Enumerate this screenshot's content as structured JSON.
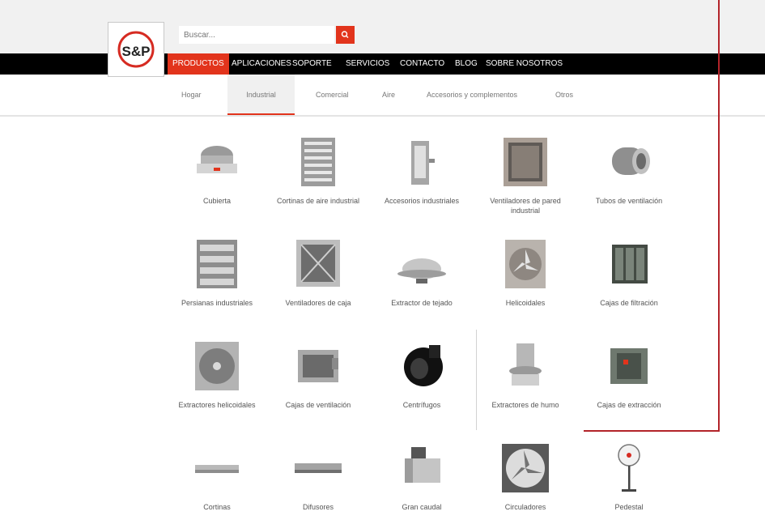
{
  "header": {
    "brand": "S&P",
    "search": {
      "value": "",
      "placeholder": "Buscar..."
    },
    "accent_color": "#e2341c"
  },
  "nav": {
    "items": [
      {
        "label": "PRODUCTOS",
        "active": true
      },
      {
        "label": "APLICACIONES"
      },
      {
        "label": "SOPORTE"
      },
      {
        "label": "SERVICIOS"
      },
      {
        "label": "CONTACTO"
      },
      {
        "label": "BLOG"
      },
      {
        "label": "SOBRE NOSOTROS"
      }
    ]
  },
  "subnav": {
    "items": [
      {
        "label": "Hogar"
      },
      {
        "label": "Industrial",
        "active": true
      },
      {
        "label": "Comercial"
      },
      {
        "label": "Aire"
      },
      {
        "label": "Accesorios y complementos"
      },
      {
        "label": "Otros"
      }
    ]
  },
  "products": [
    {
      "name": "Cubierta",
      "icon": "roof-fan-icon"
    },
    {
      "name": "Cortinas de aire industrial",
      "icon": "louver-unit-icon"
    },
    {
      "name": "Accesorios industriales",
      "icon": "door-frame-icon"
    },
    {
      "name": "Ventiladores de pared industrial",
      "icon": "wall-box-fan-icon"
    },
    {
      "name": "Tubos de ventilación",
      "icon": "duct-tube-icon"
    },
    {
      "name": "Persianas industriales",
      "icon": "shutter-grille-icon"
    },
    {
      "name": "Ventiladores de caja",
      "icon": "box-fan-icon"
    },
    {
      "name": "Extractor de tejado",
      "icon": "dome-extractor-icon"
    },
    {
      "name": "Helicoidales",
      "icon": "axial-wall-fan-icon"
    },
    {
      "name": "Cajas de filtración",
      "icon": "filter-box-icon"
    },
    {
      "name": "Extractores helicoidales",
      "icon": "square-axial-fan-icon"
    },
    {
      "name": "Cajas de ventilación",
      "icon": "cabinet-fan-icon"
    },
    {
      "name": "Centrífugos",
      "icon": "centrifugal-blower-icon"
    },
    {
      "name": "Extractores de humo",
      "icon": "roof-smoke-fan-icon"
    },
    {
      "name": "Cajas de extracción",
      "icon": "extraction-box-icon"
    },
    {
      "name": "Cortinas",
      "icon": "air-curtain-icon"
    },
    {
      "name": "Difusores",
      "icon": "diffuser-bar-icon"
    },
    {
      "name": "Gran caudal",
      "icon": "inline-duct-fan-icon"
    },
    {
      "name": "Circuladores",
      "icon": "circulator-fan-icon"
    },
    {
      "name": "Pedestal",
      "icon": "pedestal-fan-icon"
    }
  ]
}
